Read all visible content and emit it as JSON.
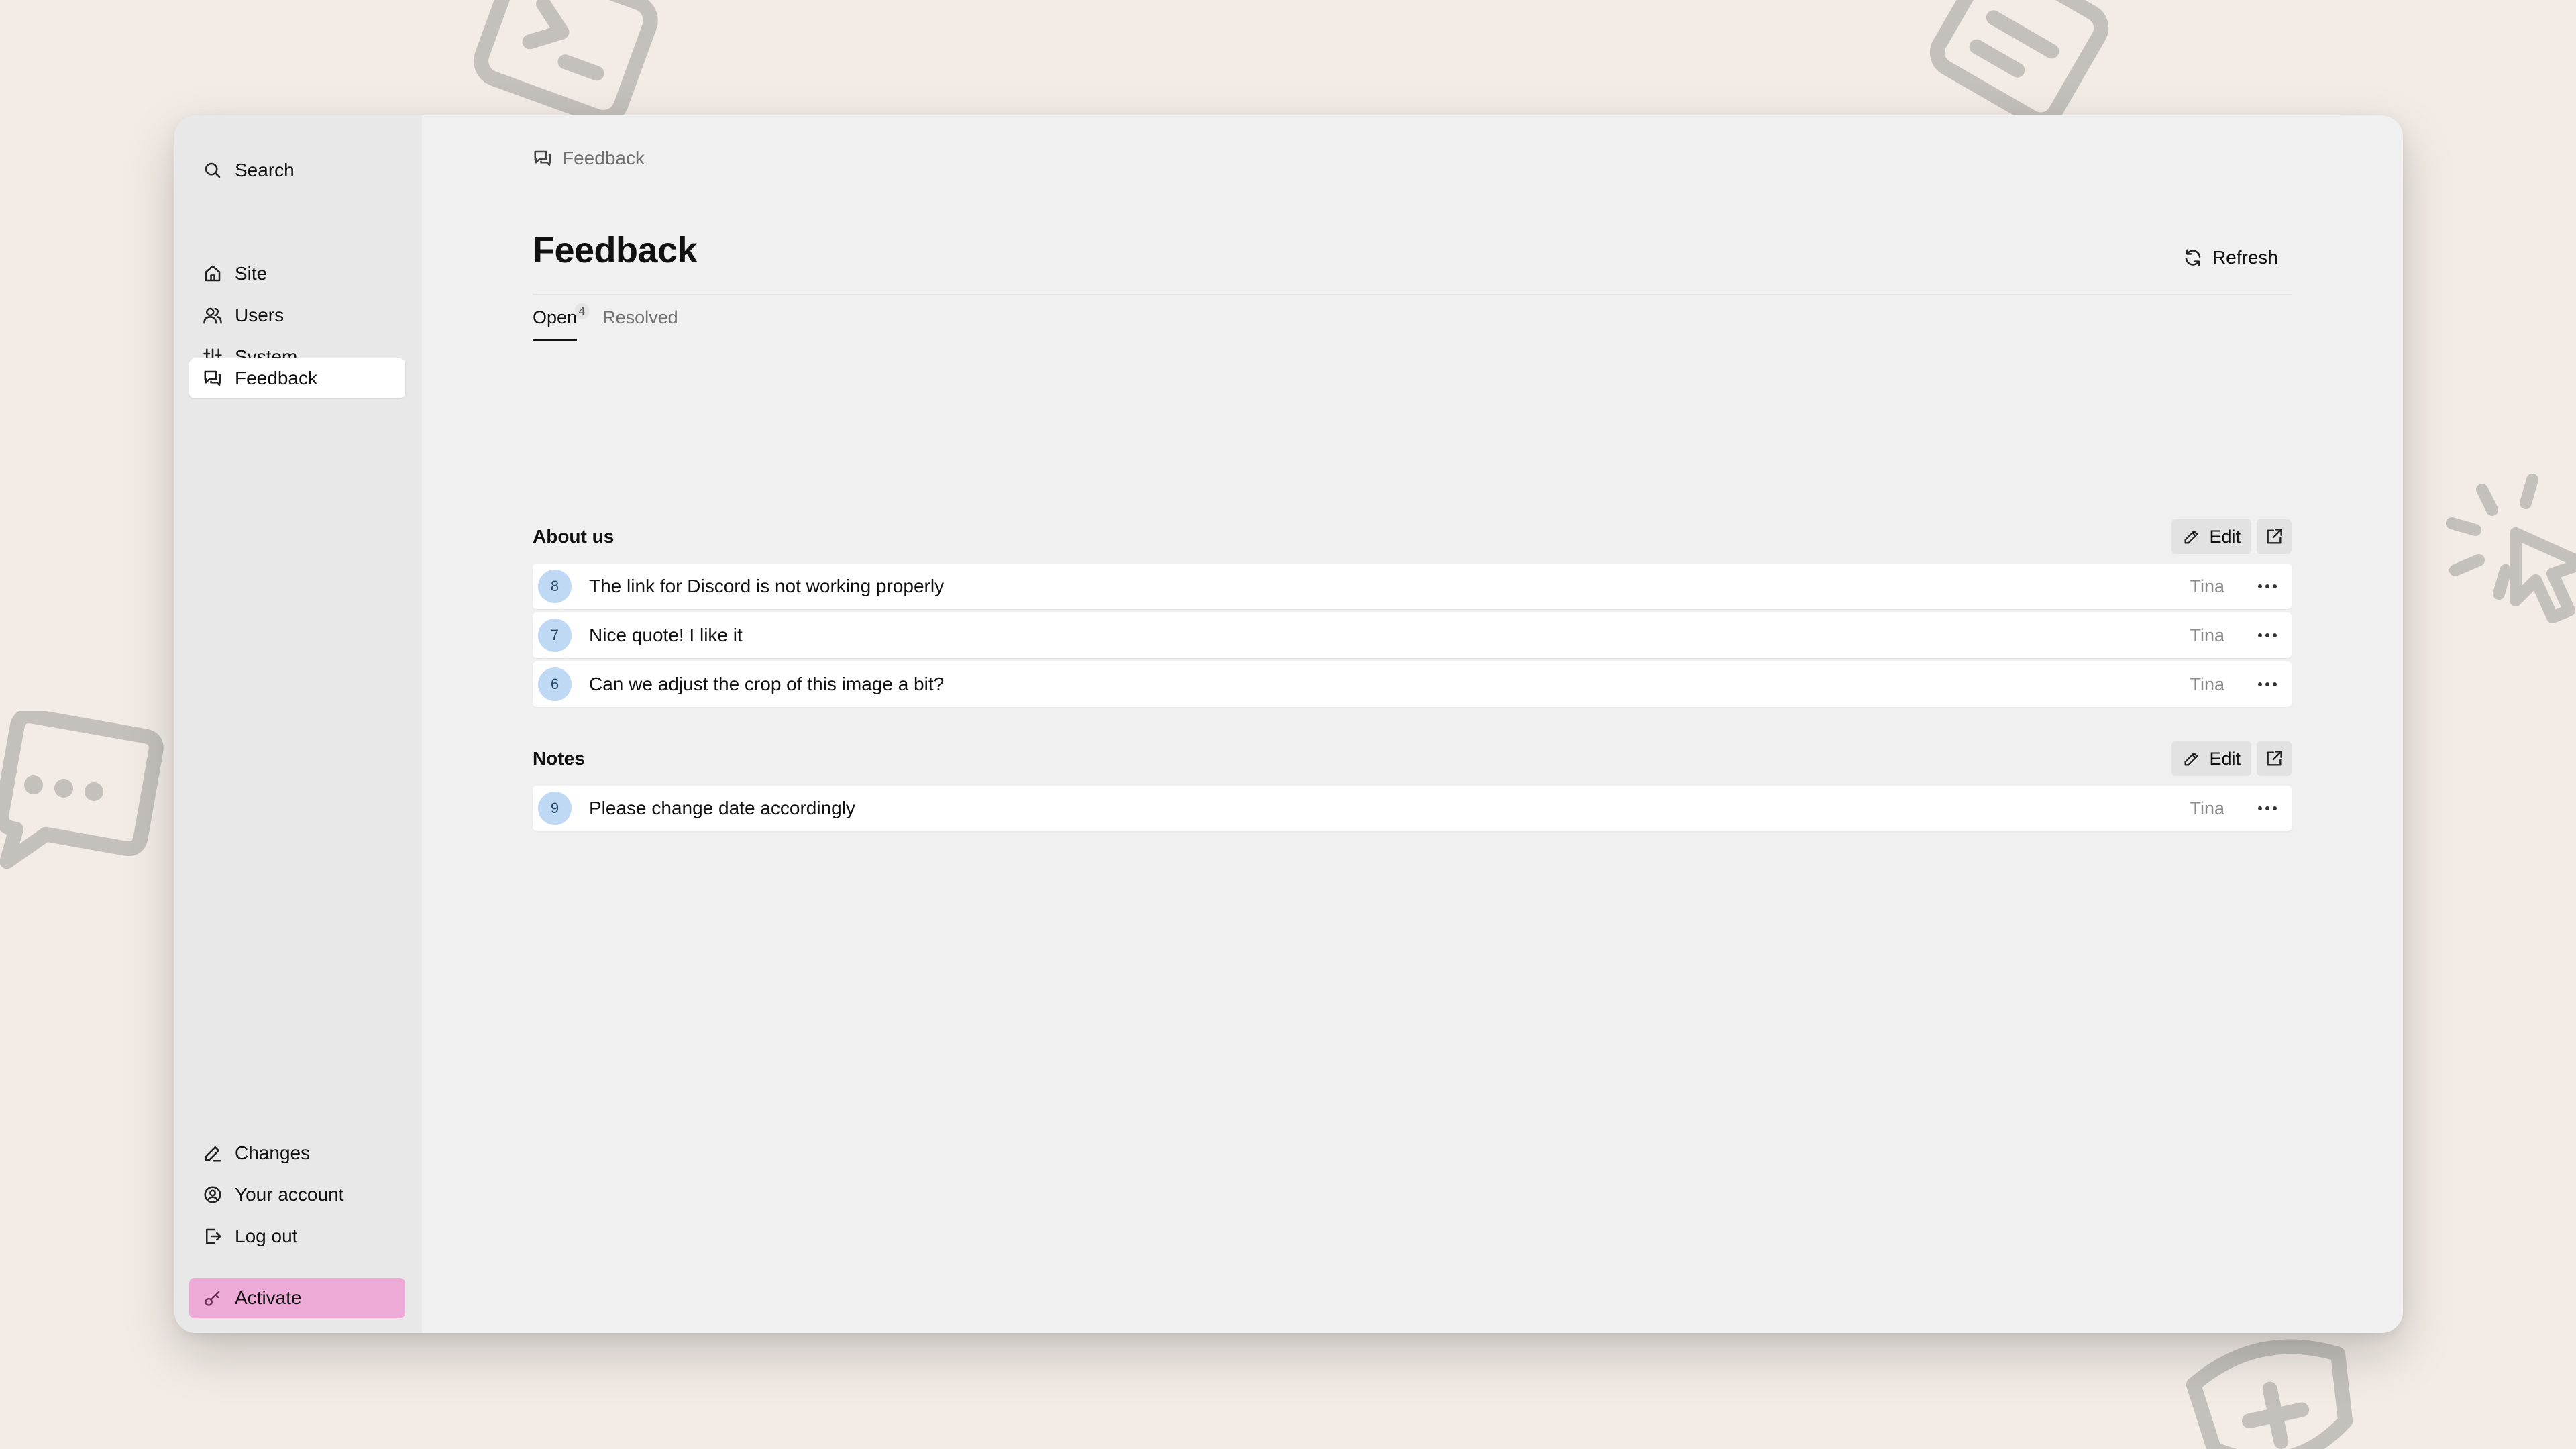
{
  "sidebar": {
    "search_label": "Search",
    "nav": [
      {
        "label": "Site",
        "icon": "home-icon"
      },
      {
        "label": "Users",
        "icon": "users-icon"
      },
      {
        "label": "System",
        "icon": "sliders-icon"
      },
      {
        "label": "Feedback",
        "icon": "chat-icon",
        "active": true
      }
    ],
    "bottom": [
      {
        "label": "Changes",
        "icon": "pencil-icon"
      },
      {
        "label": "Your account",
        "icon": "account-icon"
      },
      {
        "label": "Log out",
        "icon": "logout-icon"
      }
    ],
    "activate_label": "Activate"
  },
  "breadcrumb": {
    "label": "Feedback"
  },
  "page": {
    "title": "Feedback",
    "refresh_label": "Refresh"
  },
  "tabs": [
    {
      "label": "Open",
      "badge": "4",
      "active": true
    },
    {
      "label": "Resolved"
    }
  ],
  "sections": [
    {
      "title": "About us",
      "edit_label": "Edit",
      "items": [
        {
          "num": "8",
          "text": "The link for Discord is not working properly",
          "author": "Tina"
        },
        {
          "num": "7",
          "text": "Nice quote! I like it",
          "author": "Tina"
        },
        {
          "num": "6",
          "text": "Can we adjust the crop of this image a bit?",
          "author": "Tina"
        }
      ]
    },
    {
      "title": "Notes",
      "edit_label": "Edit",
      "items": [
        {
          "num": "9",
          "text": "Please change date accordingly",
          "author": "Tina"
        }
      ]
    }
  ],
  "colors": {
    "background": "#f2ebe6",
    "activate": "#eeaad6",
    "number_badge": "#bfd9f5"
  }
}
